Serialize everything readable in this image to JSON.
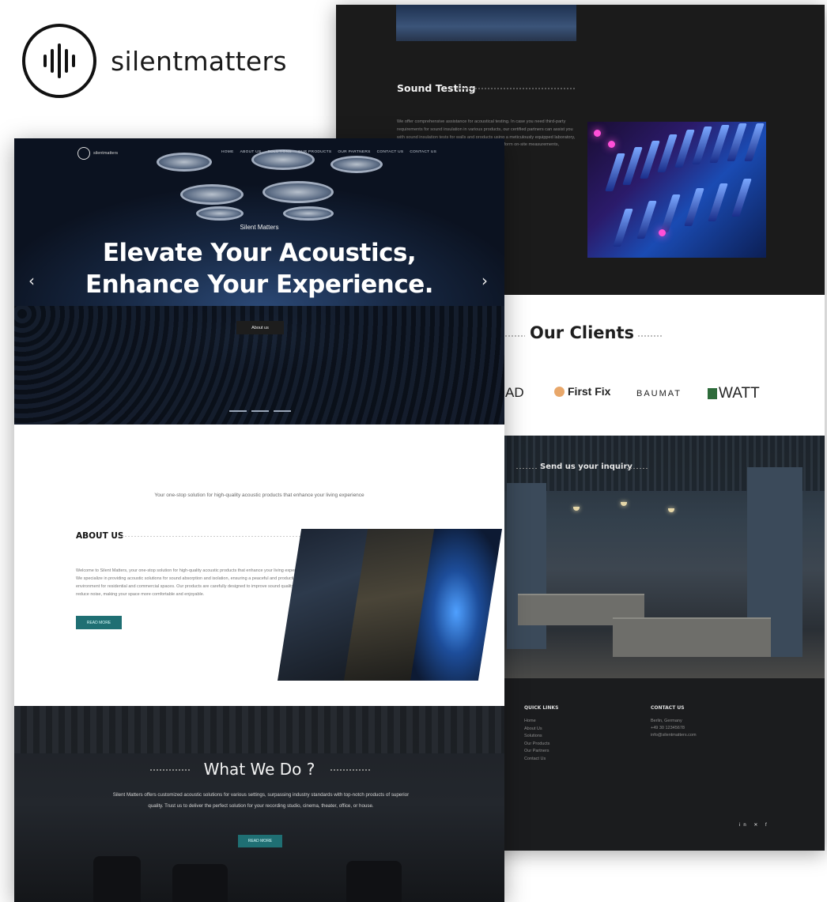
{
  "brand": {
    "logo_text": "silentmatters"
  },
  "back_page": {
    "sound_testing": {
      "title": "Sound Testing",
      "text": "We offer comprehensive assistance for acoustical testing. In case you need third-party requirements for sound insulation in various products, our certified partners can assist you with sound insulation tests for walls and products using a meticulously equipped laboratory, providing accurate results. Additionally, our experts perform on-site measurements, evaluating acoustic floors and ceilings."
    },
    "clients": {
      "title": "Our Clients",
      "logos": [
        "AD",
        "First Fix",
        "BAUMAT",
        "WATT"
      ]
    },
    "inquiry": {
      "title": "Send us your inquiry"
    },
    "footer": {
      "quick_links_title": "QUICK LINKS",
      "quick_links": [
        "Home",
        "About Us",
        "Solutions",
        "Our Products",
        "Our Partners",
        "Contact Us"
      ],
      "contact_title": "CONTACT US",
      "contact": [
        "Berlin, Germany",
        "+49 30 12345678",
        "info@silentmatters.com"
      ],
      "socials": "in  ✕  f"
    }
  },
  "front_page": {
    "nav": {
      "logo_text": "silentmatters",
      "links": [
        "HOME",
        "ABOUT US",
        "SOLUTIONS",
        "OUR PRODUCTS",
        "OUR PARTNERS",
        "CONTACT US",
        "CONTACT US"
      ]
    },
    "hero": {
      "kicker": "Silent Matters",
      "title_line1": "Elevate Your Acoustics,",
      "title_line2": "Enhance Your Experience.",
      "button": "About us",
      "prev": "‹",
      "next": "›"
    },
    "intro": "Your one-stop solution for high-quality acoustic products that enhance your living experience",
    "about": {
      "title": "ABOUT US",
      "text": "Welcome to Silent Matters, your one-stop solution for high-quality acoustic products that enhance your living experience. We specialize in providing acoustic solutions for sound absorption and isolation, ensuring a peaceful and productive environment for residential and commercial spaces. Our products are carefully designed to improve sound quality and reduce noise, making your space more comfortable and enjoyable.",
      "button": "READ MORE"
    },
    "what_we_do": {
      "title": "What We Do ?",
      "text": "Silent Matters offers customized acoustic solutions for various settings, surpassing industry standards with top-notch products of superior quality. Trust us to deliver the perfect solution for your recording studio, cinema, theater, office, or house.",
      "button": "READ MORE"
    }
  }
}
